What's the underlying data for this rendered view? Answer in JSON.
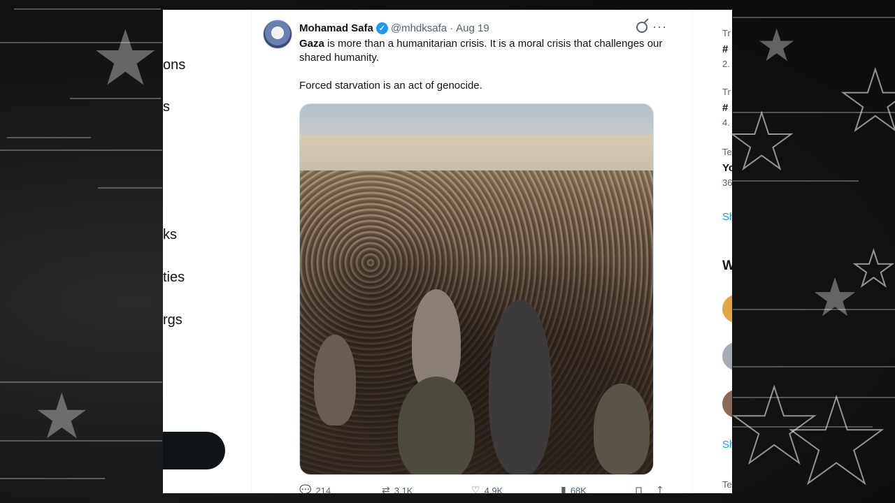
{
  "nav": {
    "items": [
      {
        "label": "ons"
      },
      {
        "label": "s"
      },
      {
        "label": "ks"
      },
      {
        "label": "ties"
      },
      {
        "label": "rgs"
      }
    ]
  },
  "tweet": {
    "author_name": "Mohamad Safa",
    "handle": "@mhdksafa",
    "separator": "·",
    "date": "Aug 19",
    "verified_mark": "✓",
    "more_label": "···",
    "text_bold": "Gaza",
    "text_line1_rest": " is more than a humanitarian crisis. It is a moral crisis that challenges our shared humanity.",
    "text_line2": "Forced starvation is an act of genocide.",
    "actions": {
      "replies": "214",
      "reposts": "3.1K",
      "likes": "4.9K",
      "views": "68K"
    }
  },
  "right_sidebar": {
    "trend1_label": "Tr",
    "trend1_name": "#",
    "trend1_count": "2.",
    "trend2_label": "Tr",
    "trend2_name": "#",
    "trend2_count": "4.",
    "trend3_label": "Te",
    "trend3_name": "Yo",
    "trend3_count": "36",
    "show_more_1": "Sh",
    "who_to_follow": "W",
    "show_more_2": "Sh",
    "footer": "Te"
  },
  "colors": {
    "accent": "#1d9bf0",
    "text": "#0f1419",
    "muted": "#536471"
  }
}
